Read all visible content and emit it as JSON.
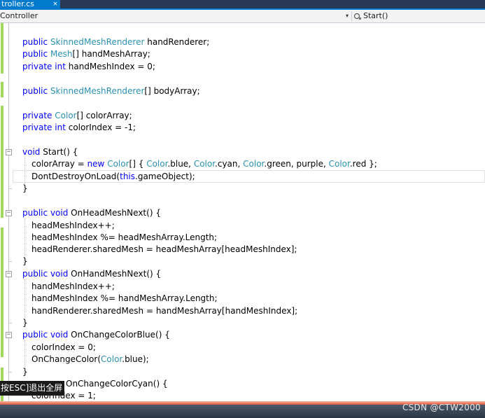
{
  "window": {
    "tab_title": "troller.cs",
    "tab_close_glyph": "×"
  },
  "navbar": {
    "class_selector": "Controller",
    "member_icon": "method-icon",
    "member_selector": "Start()",
    "dropdown_glyph": "▾"
  },
  "editor": {
    "fold_glyph": "−",
    "lines": [
      {
        "tokens": [
          {
            "t": "public",
            "c": "kw"
          },
          {
            "t": " "
          },
          {
            "t": "SkinnedMeshRenderer",
            "c": "tp"
          },
          {
            "t": " handRenderer;"
          }
        ]
      },
      {
        "tokens": [
          {
            "t": "public",
            "c": "kw"
          },
          {
            "t": " "
          },
          {
            "t": "Mesh",
            "c": "tp"
          },
          {
            "t": "[] handMeshArray;"
          }
        ]
      },
      {
        "tokens": [
          {
            "t": "private",
            "c": "kw"
          },
          {
            "t": " "
          },
          {
            "t": "int",
            "c": "kw"
          },
          {
            "t": " handMeshIndex = 0;"
          }
        ]
      },
      {
        "tokens": [
          {
            "t": "public",
            "c": "kw"
          },
          {
            "t": " "
          },
          {
            "t": "SkinnedMeshRenderer",
            "c": "tp"
          },
          {
            "t": "[] bodyArray;"
          }
        ]
      },
      {
        "tokens": [
          {
            "t": "private",
            "c": "kw"
          },
          {
            "t": " "
          },
          {
            "t": "Color",
            "c": "tp"
          },
          {
            "t": "[] colorArray;"
          }
        ]
      },
      {
        "tokens": [
          {
            "t": "private",
            "c": "kw"
          },
          {
            "t": " "
          },
          {
            "t": "int",
            "c": "kw"
          },
          {
            "t": " colorIndex = -1;"
          }
        ]
      },
      {
        "tokens": [
          {
            "t": "void",
            "c": "kw"
          },
          {
            "t": " Start() {"
          }
        ]
      },
      {
        "tokens": [
          {
            "t": "colorArray = "
          },
          {
            "t": "new",
            "c": "kw"
          },
          {
            "t": " "
          },
          {
            "t": "Color",
            "c": "tp"
          },
          {
            "t": "[] { "
          },
          {
            "t": "Color",
            "c": "tp"
          },
          {
            "t": ".blue, "
          },
          {
            "t": "Color",
            "c": "tp"
          },
          {
            "t": ".cyan, "
          },
          {
            "t": "Color",
            "c": "tp"
          },
          {
            "t": ".green, purple, "
          },
          {
            "t": "Color",
            "c": "tp"
          },
          {
            "t": ".red };"
          }
        ]
      },
      {
        "tokens": [
          {
            "t": "DontDestroyOnLoad("
          },
          {
            "t": "this",
            "c": "kw"
          },
          {
            "t": ".gameObject);"
          }
        ]
      },
      {
        "tokens": [
          {
            "t": "}"
          }
        ]
      },
      {
        "tokens": [
          {
            "t": "public",
            "c": "kw"
          },
          {
            "t": " "
          },
          {
            "t": "void",
            "c": "kw"
          },
          {
            "t": " OnHeadMeshNext() {"
          }
        ]
      },
      {
        "tokens": [
          {
            "t": "headMeshIndex++;"
          }
        ]
      },
      {
        "tokens": [
          {
            "t": "headMeshIndex %= headMeshArray.Length;"
          }
        ]
      },
      {
        "tokens": [
          {
            "t": "headRenderer.sharedMesh = headMeshArray[headMeshIndex];"
          }
        ]
      },
      {
        "tokens": [
          {
            "t": "}"
          }
        ]
      },
      {
        "tokens": [
          {
            "t": "public",
            "c": "kw"
          },
          {
            "t": " "
          },
          {
            "t": "void",
            "c": "kw"
          },
          {
            "t": " OnHandMeshNext() {"
          }
        ]
      },
      {
        "tokens": [
          {
            "t": "handMeshIndex++;"
          }
        ]
      },
      {
        "tokens": [
          {
            "t": "handMeshIndex %= handMeshArray.Length;"
          }
        ]
      },
      {
        "tokens": [
          {
            "t": "handRenderer.sharedMesh = handMeshArray[handMeshIndex];"
          }
        ]
      },
      {
        "tokens": [
          {
            "t": "}"
          }
        ]
      },
      {
        "tokens": [
          {
            "t": "public",
            "c": "kw"
          },
          {
            "t": " "
          },
          {
            "t": "void",
            "c": "kw"
          },
          {
            "t": " OnChangeColorBlue() {"
          }
        ]
      },
      {
        "tokens": [
          {
            "t": "colorIndex = 0;"
          }
        ]
      },
      {
        "tokens": [
          {
            "t": "OnChangeColor("
          },
          {
            "t": "Color",
            "c": "tp"
          },
          {
            "t": ".blue);"
          }
        ]
      },
      {
        "tokens": [
          {
            "t": "}"
          }
        ]
      },
      {
        "tokens": [
          {
            "t": "OnChangeColorCyan() {"
          }
        ]
      },
      {
        "tokens": [
          {
            "t": "colorIndex = 1;"
          }
        ]
      }
    ]
  },
  "overlay": {
    "esc_hint": "按ESC]退出全屏"
  },
  "watermark": "CSDN @CTW2000",
  "colors": {
    "keyword": "#0000ff",
    "type": "#2b91af",
    "change_bar": "#9fd85a",
    "accent": "#007acc"
  }
}
